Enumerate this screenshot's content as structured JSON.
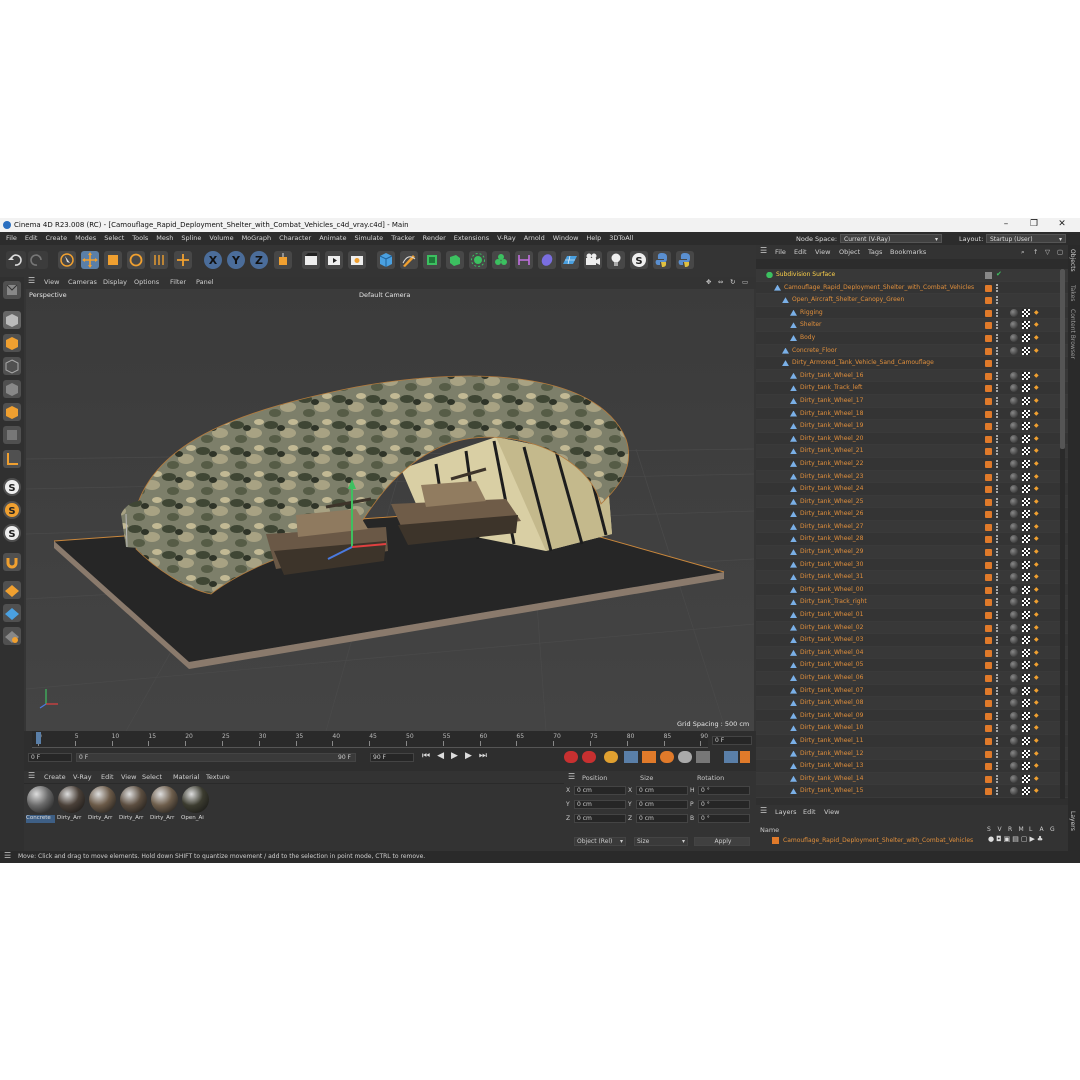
{
  "window": {
    "title": "Cinema 4D R23.008 (RC) - [Camouflage_Rapid_Deployment_Shelter_with_Combat_Vehicles_c4d_vray.c4d] - Main"
  },
  "menubar": {
    "items": [
      "File",
      "Edit",
      "Create",
      "Modes",
      "Select",
      "Tools",
      "Mesh",
      "Spline",
      "Volume",
      "MoGraph",
      "Character",
      "Animate",
      "Simulate",
      "Tracker",
      "Render",
      "Extensions",
      "V-Ray",
      "Arnold",
      "Window",
      "Help",
      "3DToAll"
    ],
    "node_space_label": "Node Space:",
    "node_space_value": "Current (V-Ray)",
    "layout_label": "Layout:",
    "layout_value": "Startup (User)"
  },
  "viewport": {
    "menu": [
      "View",
      "Cameras",
      "Display",
      "Options",
      "Filter",
      "Panel"
    ],
    "name": "Perspective",
    "camera": "Default Camera",
    "grid_spacing": "Grid Spacing : 500 cm"
  },
  "timeline": {
    "ticks": [
      "0",
      "5",
      "10",
      "15",
      "20",
      "25",
      "30",
      "35",
      "40",
      "45",
      "50",
      "55",
      "60",
      "65",
      "70",
      "75",
      "80",
      "85",
      "90"
    ],
    "current_frame": "0 F",
    "start_field": "0 F",
    "start_field2": "0 F",
    "end_field": "90 F",
    "end_field2": "90 F"
  },
  "materials": {
    "menu": [
      "Create",
      "V-Ray",
      "Edit",
      "View",
      "Select",
      "Material",
      "Texture"
    ],
    "items": [
      "Concrete",
      "Dirty_Arr",
      "Dirty_Arr",
      "Dirty_Arr",
      "Dirty_Arr",
      "Open_Ai"
    ]
  },
  "coords": {
    "headers": [
      "Position",
      "Size",
      "Rotation"
    ],
    "rows": [
      {
        "axis": "X",
        "pos": "0 cm",
        "saxis": "X",
        "size": "0 cm",
        "raxis": "H",
        "rot": "0 °"
      },
      {
        "axis": "Y",
        "pos": "0 cm",
        "saxis": "Y",
        "size": "0 cm",
        "raxis": "P",
        "rot": "0 °"
      },
      {
        "axis": "Z",
        "pos": "0 cm",
        "saxis": "Z",
        "size": "0 cm",
        "raxis": "B",
        "rot": "0 °"
      }
    ],
    "mode": "Object (Rel)",
    "size_mode": "Size",
    "apply": "Apply"
  },
  "object_manager": {
    "menu": [
      "File",
      "Edit",
      "View",
      "Object",
      "Tags",
      "Bookmarks"
    ],
    "rows": [
      {
        "name": "Subdivision Surface",
        "indent": 0,
        "color": "yellow"
      },
      {
        "name": "Camouflage_Rapid_Deployment_Shelter_with_Combat_Vehicles",
        "indent": 1,
        "color": "orange"
      },
      {
        "name": "Open_Aircraft_Shelter_Canopy_Green",
        "indent": 2,
        "color": "orange"
      },
      {
        "name": "Rigging",
        "indent": 3,
        "color": "orange"
      },
      {
        "name": "Shelter",
        "indent": 3,
        "color": "orange"
      },
      {
        "name": "Body",
        "indent": 3,
        "color": "orange"
      },
      {
        "name": "Concrete_Floor",
        "indent": 2,
        "color": "orange"
      },
      {
        "name": "Dirty_Armored_Tank_Vehicle_Sand_Camouflage",
        "indent": 2,
        "color": "orange"
      },
      {
        "name": "Dirty_tank_Wheel_16",
        "indent": 3,
        "color": "orange"
      },
      {
        "name": "Dirty_tank_Track_left",
        "indent": 3,
        "color": "orange"
      },
      {
        "name": "Dirty_tank_Wheel_17",
        "indent": 3,
        "color": "orange"
      },
      {
        "name": "Dirty_tank_Wheel_18",
        "indent": 3,
        "color": "orange"
      },
      {
        "name": "Dirty_tank_Wheel_19",
        "indent": 3,
        "color": "orange"
      },
      {
        "name": "Dirty_tank_Wheel_20",
        "indent": 3,
        "color": "orange"
      },
      {
        "name": "Dirty_tank_Wheel_21",
        "indent": 3,
        "color": "orange"
      },
      {
        "name": "Dirty_tank_Wheel_22",
        "indent": 3,
        "color": "orange"
      },
      {
        "name": "Dirty_tank_Wheel_23",
        "indent": 3,
        "color": "orange"
      },
      {
        "name": "Dirty_tank_Wheel_24",
        "indent": 3,
        "color": "orange"
      },
      {
        "name": "Dirty_tank_Wheel_25",
        "indent": 3,
        "color": "orange"
      },
      {
        "name": "Dirty_tank_Wheel_26",
        "indent": 3,
        "color": "orange"
      },
      {
        "name": "Dirty_tank_Wheel_27",
        "indent": 3,
        "color": "orange"
      },
      {
        "name": "Dirty_tank_Wheel_28",
        "indent": 3,
        "color": "orange"
      },
      {
        "name": "Dirty_tank_Wheel_29",
        "indent": 3,
        "color": "orange"
      },
      {
        "name": "Dirty_tank_Wheel_30",
        "indent": 3,
        "color": "orange"
      },
      {
        "name": "Dirty_tank_Wheel_31",
        "indent": 3,
        "color": "orange"
      },
      {
        "name": "Dirty_tank_Wheel_00",
        "indent": 3,
        "color": "orange"
      },
      {
        "name": "Dirty_tank_Track_right",
        "indent": 3,
        "color": "orange"
      },
      {
        "name": "Dirty_tank_Wheel_01",
        "indent": 3,
        "color": "orange"
      },
      {
        "name": "Dirty_tank_Wheel_02",
        "indent": 3,
        "color": "orange"
      },
      {
        "name": "Dirty_tank_Wheel_03",
        "indent": 3,
        "color": "orange"
      },
      {
        "name": "Dirty_tank_Wheel_04",
        "indent": 3,
        "color": "orange"
      },
      {
        "name": "Dirty_tank_Wheel_05",
        "indent": 3,
        "color": "orange"
      },
      {
        "name": "Dirty_tank_Wheel_06",
        "indent": 3,
        "color": "orange"
      },
      {
        "name": "Dirty_tank_Wheel_07",
        "indent": 3,
        "color": "orange"
      },
      {
        "name": "Dirty_tank_Wheel_08",
        "indent": 3,
        "color": "orange"
      },
      {
        "name": "Dirty_tank_Wheel_09",
        "indent": 3,
        "color": "orange"
      },
      {
        "name": "Dirty_tank_Wheel_10",
        "indent": 3,
        "color": "orange"
      },
      {
        "name": "Dirty_tank_Wheel_11",
        "indent": 3,
        "color": "orange"
      },
      {
        "name": "Dirty_tank_Wheel_12",
        "indent": 3,
        "color": "orange"
      },
      {
        "name": "Dirty_tank_Wheel_13",
        "indent": 3,
        "color": "orange"
      },
      {
        "name": "Dirty_tank_Wheel_14",
        "indent": 3,
        "color": "orange"
      },
      {
        "name": "Dirty_tank_Wheel_15",
        "indent": 3,
        "color": "orange"
      }
    ]
  },
  "layers": {
    "menu": [
      "Layers",
      "Edit",
      "View"
    ],
    "name_header": "Name",
    "flags": [
      "S",
      "V",
      "R",
      "M",
      "L",
      "A",
      "G"
    ],
    "layer_name": "Camouflage_Rapid_Deployment_Shelter_with_Combat_Vehicles"
  },
  "side_tabs": [
    "Objects",
    "Takes",
    "Content Browser",
    "Layers"
  ],
  "status": "Move: Click and drag to move elements. Hold down SHIFT to quantize movement / add to the selection in point mode, CTRL to remove.",
  "colors": {
    "accent": "#e07a2a",
    "selection": "#5a7fa8",
    "title_yellow": "#ffd24a"
  }
}
